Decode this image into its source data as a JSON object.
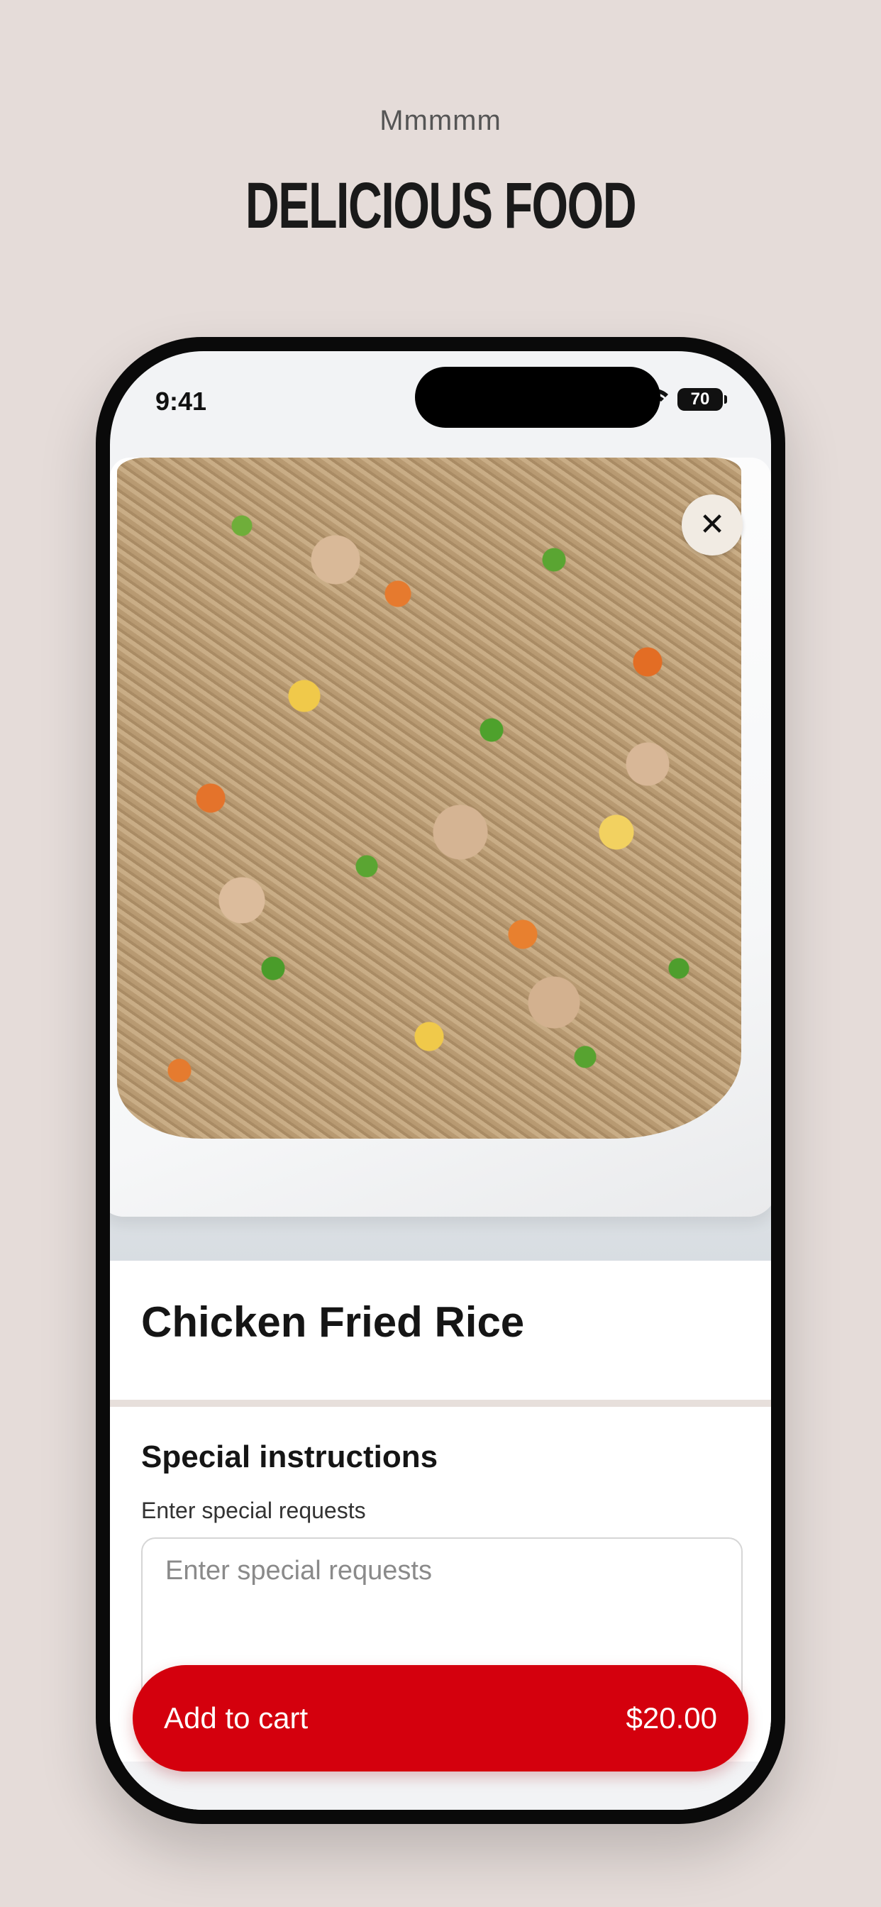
{
  "promo": {
    "tagline": "Mmmmm",
    "headline": "DELICIOUS FOOD"
  },
  "status_bar": {
    "time": "9:41",
    "battery": "70",
    "icons": [
      "signal-icon",
      "wifi-icon",
      "battery-icon"
    ]
  },
  "item": {
    "title": "Chicken Fried Rice",
    "image_icon": "food-photo",
    "close_icon": "close-icon"
  },
  "instructions": {
    "heading": "Special instructions",
    "label": "Enter special requests",
    "placeholder": "Enter special requests",
    "value": ""
  },
  "cart": {
    "label": "Add to cart",
    "price": "$20.00"
  },
  "colors": {
    "background": "#e5dcd9",
    "accent": "#d4000d",
    "close_button": "#f1ebe3"
  }
}
